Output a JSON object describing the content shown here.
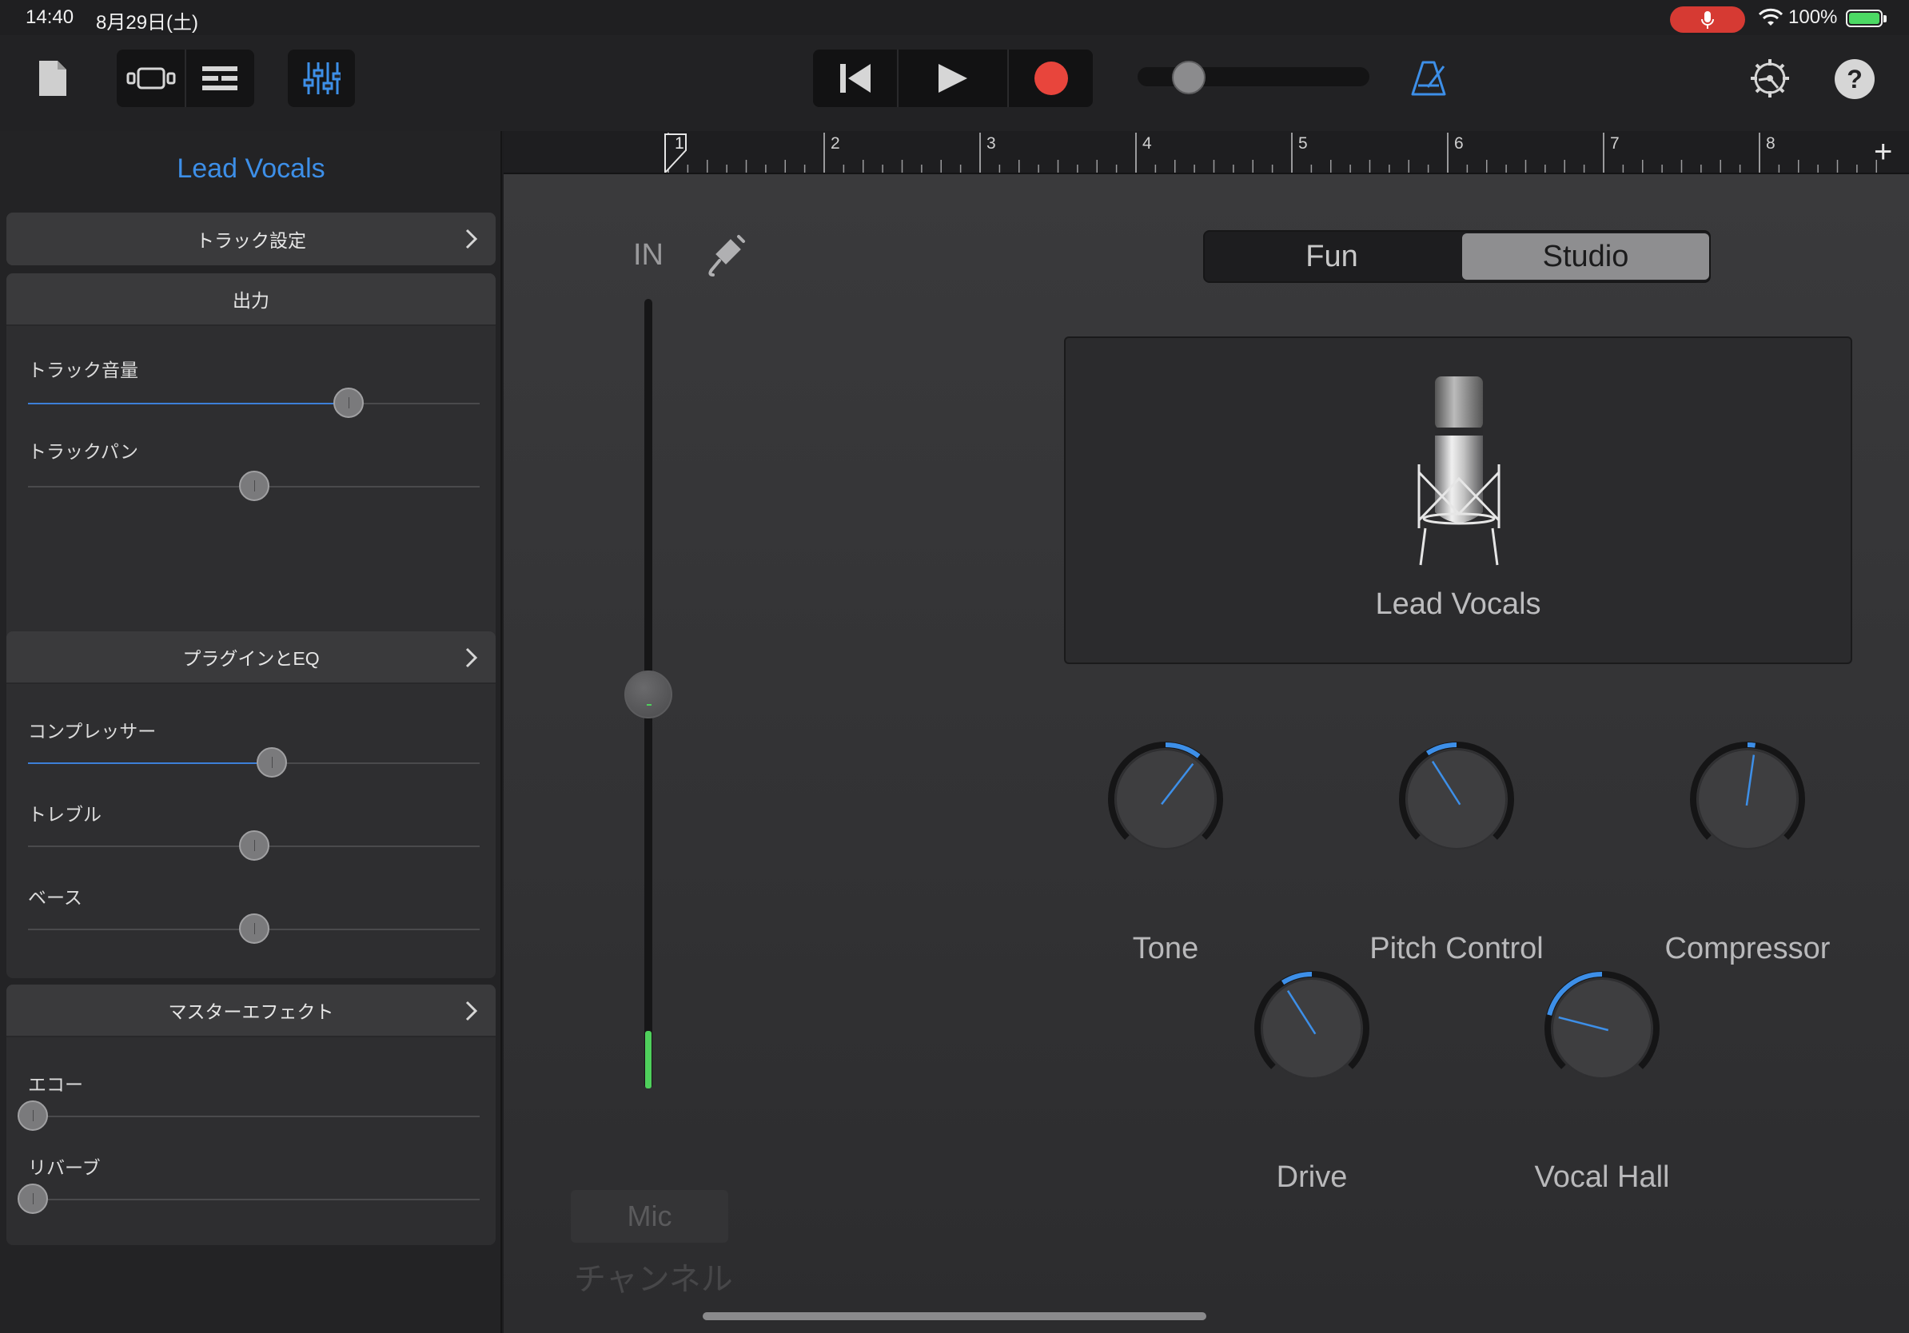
{
  "status_bar": {
    "time": "14:40",
    "date": "8月29日(土)",
    "battery": "100%"
  },
  "toolbar": {
    "icons": [
      "document-icon",
      "tracks-view-icon",
      "live-loops-icon",
      "mixer-icon",
      "rewind-icon",
      "play-icon",
      "record-icon",
      "metronome-icon",
      "settings-icon",
      "help-icon"
    ],
    "accent": "#3d8fe8",
    "record_color": "#e8453c"
  },
  "inspector": {
    "title": "Lead Vocals",
    "track_settings": "トラック設定",
    "output": {
      "header": "出力",
      "track_volume": {
        "label": "トラック音量",
        "value": 0.71
      },
      "track_pan": {
        "label": "トラックパン",
        "value": 0.5
      }
    },
    "plugins": {
      "header": "プラグインとEQ",
      "compressor": {
        "label": "コンプレッサー",
        "value": 0.54
      },
      "treble": {
        "label": "トレブル",
        "value": 0.5
      },
      "bass": {
        "label": "ベース",
        "value": 0.5
      }
    },
    "master": {
      "header": "マスターエフェクト",
      "echo": {
        "label": "エコー",
        "value": 0.0
      },
      "reverb": {
        "label": "リバーブ",
        "value": 0.0
      }
    }
  },
  "ruler": {
    "bars": [
      "1",
      "2",
      "3",
      "4",
      "5",
      "6",
      "7",
      "8"
    ],
    "add_label": "+"
  },
  "input": {
    "label": "IN",
    "mic_button": "Mic",
    "channel_label": "チャンネル",
    "level_color": "#4fd05c"
  },
  "mode": {
    "fun": "Fun",
    "studio": "Studio",
    "selected": "Studio"
  },
  "patch": {
    "name": "Lead Vocals"
  },
  "knobs": [
    {
      "label": "Tone",
      "value": 0.64
    },
    {
      "label": "Pitch Control",
      "value": 0.38
    },
    {
      "label": "Compressor",
      "value": 0.53
    },
    {
      "label": "Drive",
      "value": 0.38
    },
    {
      "label": "Vocal Hall",
      "value": 0.22
    }
  ]
}
